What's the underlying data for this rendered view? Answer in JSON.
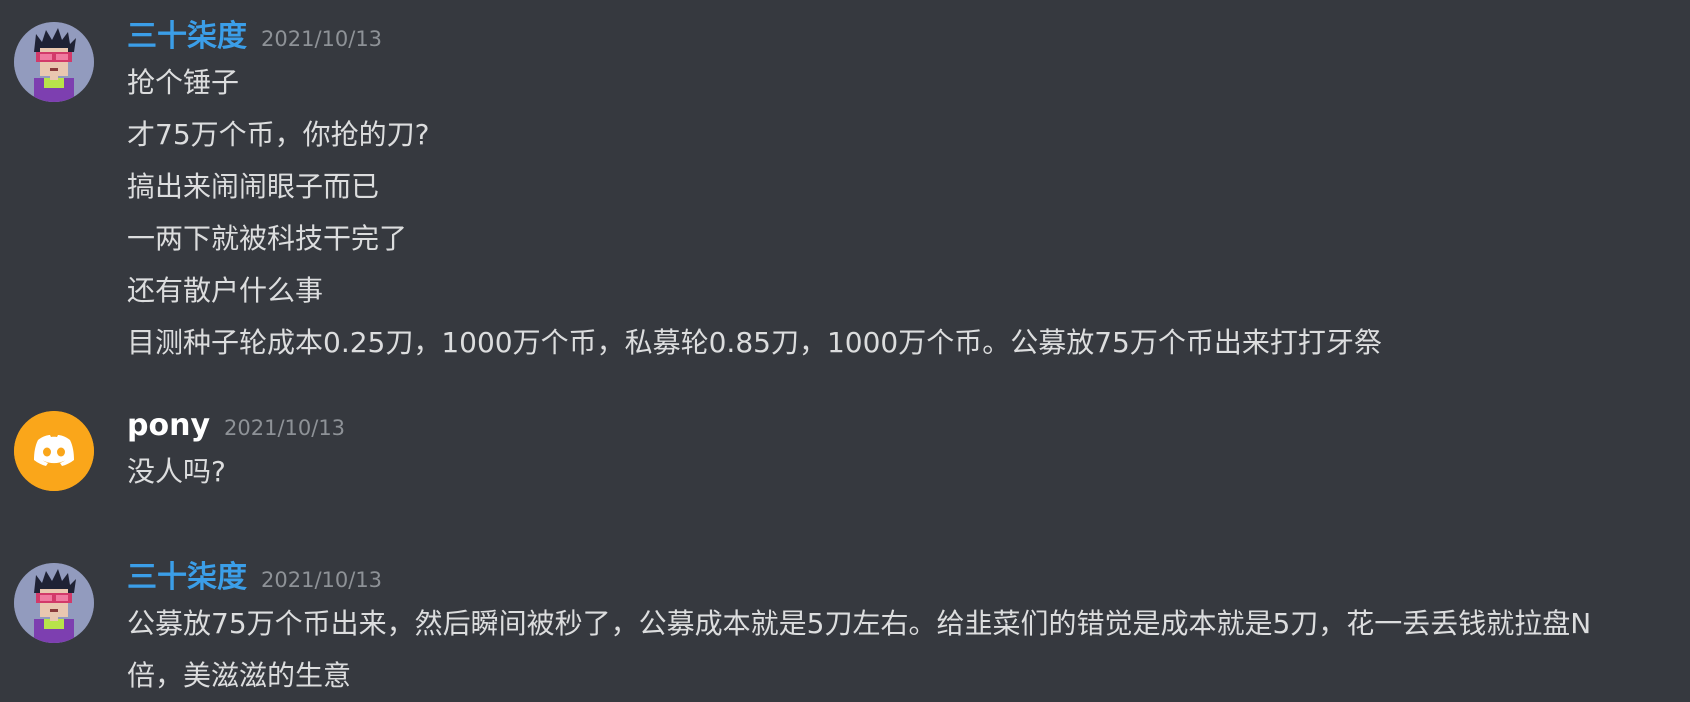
{
  "colors": {
    "background": "#36393f",
    "message_text": "#dcddde",
    "timestamp": "#8e9297",
    "username_role": "#3b9ee8",
    "username_plain": "#ffffff",
    "discord_avatar_bg": "#faa61a"
  },
  "groups": [
    {
      "username": "三十柒度",
      "timestamp": "2021/10/13",
      "avatar_icon": "pixel-character-avatar",
      "messages": [
        "抢个锤子",
        "才75万个币，你抢的刀?",
        "搞出来闹闹眼子而已",
        "一两下就被科技干完了",
        "还有散户什么事",
        "目测种子轮成本0.25刀，1000万个币，私募轮0.85刀，1000万个币。公募放75万个币出来打打牙祭"
      ]
    },
    {
      "username": "pony",
      "timestamp": "2021/10/13",
      "avatar_icon": "discord-logo-icon",
      "messages": [
        "没人吗?"
      ]
    },
    {
      "username": "三十柒度",
      "timestamp": "2021/10/13",
      "avatar_icon": "pixel-character-avatar",
      "messages": [
        "公募放75万个币出来，然后瞬间被秒了，公募成本就是5刀左右。给韭菜们的错觉是成本就是5刀，花一丢丢钱就拉盘N倍，美滋滋的生意"
      ]
    }
  ]
}
